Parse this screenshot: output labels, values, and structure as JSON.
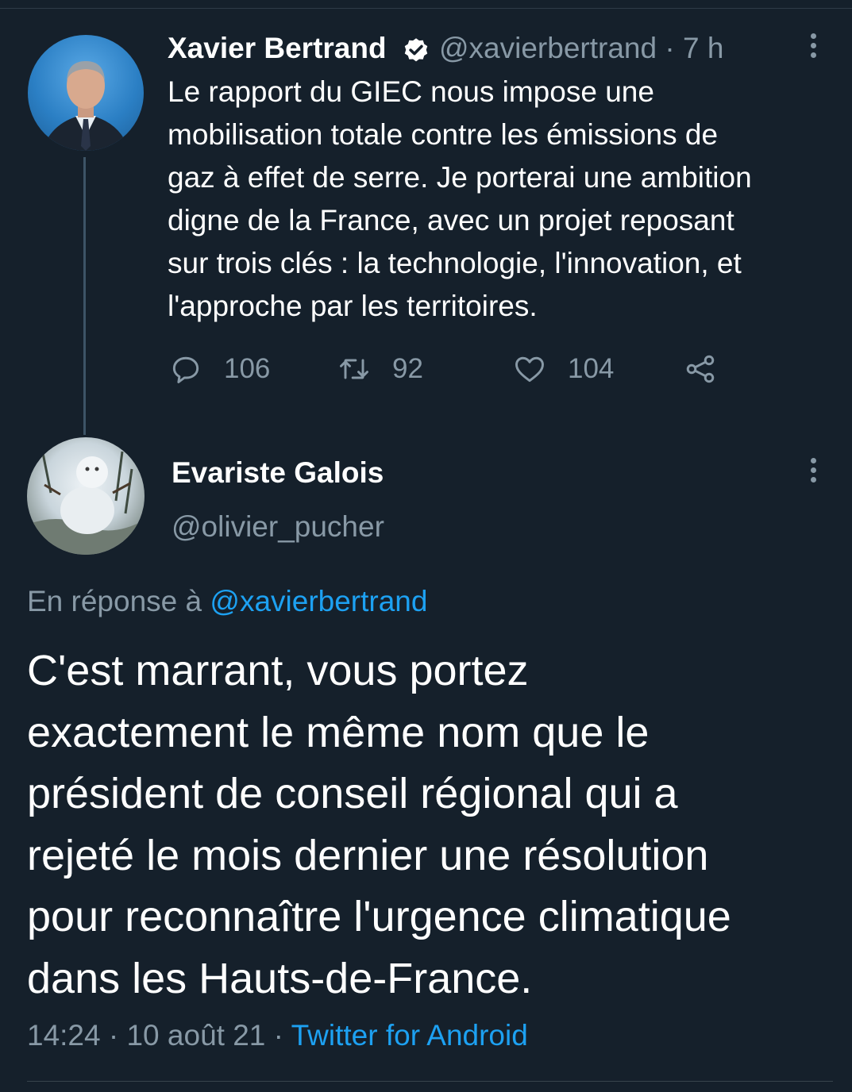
{
  "theme": {
    "background": "#15202b",
    "text_primary": "#ffffff",
    "text_secondary": "#8899a6",
    "accent": "#1da1f2"
  },
  "parent_tweet": {
    "author_name": "Xavier Bertrand",
    "verified": true,
    "handle": "@xavierbertrand",
    "separator": "·",
    "time_ago": "7 h",
    "text_lines": [
      "Le rapport du GIEC nous impose une",
      "mobilisation totale contre les émissions de",
      "gaz à effet de serre. Je porterai une ambition",
      "digne de la France, avec un projet reposant",
      "sur trois clés : la technologie, l'innovation, et",
      "l'approche par les territoires."
    ],
    "actions": {
      "replies": "106",
      "retweets": "92",
      "likes": "104"
    },
    "icons": {
      "avatar": "profile-photo",
      "verified": "verified-badge-icon",
      "more": "more-vertical-icon",
      "reply": "reply-bubble-icon",
      "retweet": "retweet-icon",
      "like": "heart-icon",
      "share": "share-icon"
    }
  },
  "reply_tweet": {
    "author_name": "Evariste Galois",
    "handle": "@olivier_pucher",
    "in_reply_to_prefix": "En réponse à",
    "in_reply_to_handle": "@xavierbertrand",
    "text_lines": [
      "C'est marrant, vous portez",
      "exactement le même nom que le",
      "président de conseil régional qui a",
      "rejeté le mois dernier une résolution",
      "pour reconnaître l'urgence climatique",
      "dans les Hauts-de-France."
    ],
    "time": "14:24",
    "separator": "·",
    "date": "10 août 21",
    "source": "Twitter for Android"
  }
}
